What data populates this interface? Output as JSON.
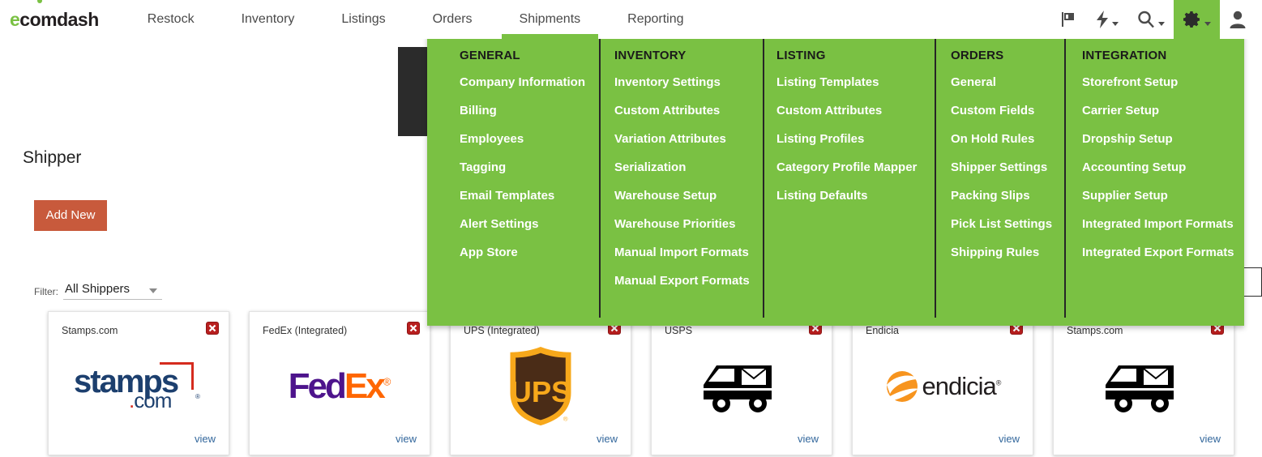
{
  "brand": {
    "logo_e": "e",
    "logo_rest": "comdash"
  },
  "nav": {
    "items": [
      {
        "label": "Restock",
        "active": false
      },
      {
        "label": "Inventory",
        "active": false
      },
      {
        "label": "Listings",
        "active": false
      },
      {
        "label": "Orders",
        "active": false
      },
      {
        "label": "Shipments",
        "active": true
      },
      {
        "label": "Reporting",
        "active": false
      }
    ],
    "icons": [
      {
        "name": "flag-icon",
        "caret": false,
        "active": false
      },
      {
        "name": "lightning-bolt-icon",
        "caret": true,
        "active": false
      },
      {
        "name": "search-icon",
        "caret": true,
        "active": false
      },
      {
        "name": "gear-icon",
        "caret": true,
        "active": true
      },
      {
        "name": "user-avatar-icon",
        "caret": false,
        "active": false
      }
    ]
  },
  "page": {
    "title": "Shipper",
    "add_new_label": "Add New",
    "filter_label": "Filter:",
    "filter_value": "All Shippers"
  },
  "cards": [
    {
      "title": "Stamps.com",
      "logo": "stamps",
      "view_label": "view",
      "delete_label": "x"
    },
    {
      "title": "FedEx (Integrated)",
      "logo": "fedex",
      "view_label": "view",
      "delete_label": "x"
    },
    {
      "title": "UPS (Integrated)",
      "logo": "ups",
      "view_label": "view",
      "delete_label": "x"
    },
    {
      "title": "USPS",
      "logo": "truck",
      "view_label": "view",
      "delete_label": "x"
    },
    {
      "title": "Endicia",
      "logo": "endicia",
      "view_label": "view",
      "delete_label": "x"
    },
    {
      "title": "Stamps.com",
      "logo": "truck",
      "view_label": "view",
      "delete_label": "x"
    }
  ],
  "settings_menu": {
    "columns": [
      {
        "heading": "GENERAL",
        "items": [
          "Company Information",
          "Billing",
          "Employees",
          "Tagging",
          "Email Templates",
          "Alert Settings",
          "App Store"
        ]
      },
      {
        "heading": "INVENTORY",
        "items": [
          "Inventory Settings",
          "Custom Attributes",
          "Variation Attributes",
          "Serialization",
          "Warehouse Setup",
          "Warehouse Priorities",
          "Manual Import Formats",
          "Manual Export Formats"
        ]
      },
      {
        "heading": "LISTING",
        "items": [
          "Listing Templates",
          "Custom Attributes",
          "Listing Profiles",
          "Category Profile Mapper",
          "Listing Defaults"
        ]
      },
      {
        "heading": "ORDERS",
        "items": [
          "General",
          "Custom Fields",
          "On Hold Rules",
          "Shipper Settings",
          "Packing Slips",
          "Pick List Settings",
          "Shipping Rules"
        ]
      },
      {
        "heading": "INTEGRATION",
        "items": [
          "Storefront Setup",
          "Carrier Setup",
          "Dropship Setup",
          "Accounting Setup",
          "Supplier Setup",
          "Integrated Import Formats",
          "Integrated Export Formats"
        ]
      }
    ]
  },
  "colors": {
    "brand_green": "#7ac143",
    "button_orange": "#c85a3c",
    "link_blue": "#33679c",
    "delete_red": "#b81f1f",
    "dark_panel": "#2b2b2b"
  }
}
